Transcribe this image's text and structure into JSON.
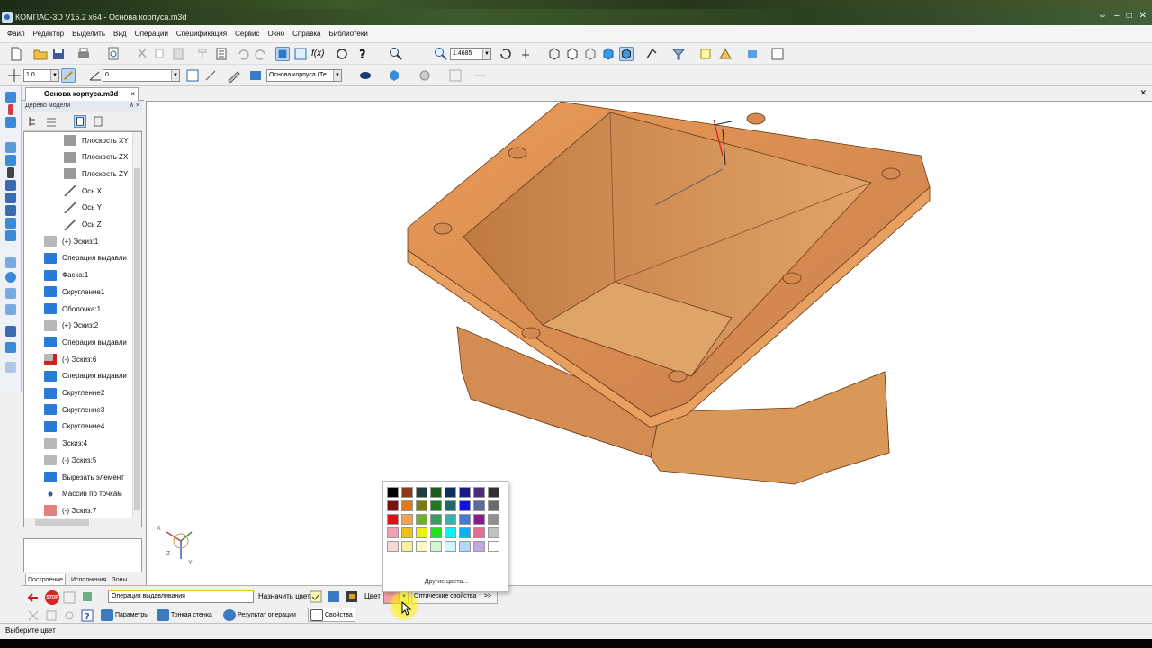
{
  "window": {
    "title": "КОМПАС-3D V15.2  x64 - Основа корпуса.m3d",
    "controls": [
      "⇔",
      "‒",
      "□",
      "✕"
    ]
  },
  "menu": [
    "Файл",
    "Редактор",
    "Выделить",
    "Вид",
    "Операции",
    "Спецификация",
    "Сервис",
    "Окно",
    "Справка",
    "Библиотеки"
  ],
  "toolbar": {
    "zoom_value": "1.4685",
    "step_value": "1.0",
    "angle_value": "0",
    "layer_value": "Основа корпуса (Те"
  },
  "document_tab": {
    "label": "Основа корпуса.m3d",
    "close": "×"
  },
  "tree": {
    "header": "Дерево модели",
    "pin": "⊼ ×",
    "items": [
      {
        "label": "Плоскость XY",
        "icon": "plane-icon",
        "indent": 2
      },
      {
        "label": "Плоскость ZX",
        "icon": "plane-icon",
        "indent": 2
      },
      {
        "label": "Плоскость ZY",
        "icon": "plane-icon",
        "indent": 2
      },
      {
        "label": "Ось X",
        "icon": "axis-icon",
        "indent": 2
      },
      {
        "label": "Ось Y",
        "icon": "axis-icon",
        "indent": 2
      },
      {
        "label": "Ось Z",
        "icon": "axis-icon",
        "indent": 2
      },
      {
        "label": "(+) Эскиз:1",
        "icon": "sketch-icon",
        "indent": 1
      },
      {
        "label": "Операция выдавли",
        "icon": "extrude-icon",
        "indent": 1
      },
      {
        "label": "Фаска:1",
        "icon": "chamfer-icon",
        "indent": 1
      },
      {
        "label": "Скругление1",
        "icon": "fillet-icon",
        "indent": 1
      },
      {
        "label": "Оболочка:1",
        "icon": "shell-icon",
        "indent": 1
      },
      {
        "label": "(+) Эскиз:2",
        "icon": "sketch-icon",
        "indent": 1
      },
      {
        "label": "Операция выдавли",
        "icon": "extrude-icon",
        "indent": 1
      },
      {
        "label": "(-) Эскиз:6",
        "icon": "sketch-error-icon",
        "indent": 1
      },
      {
        "label": "Операция выдавли",
        "icon": "extrude-icon",
        "indent": 1
      },
      {
        "label": "Скругление2",
        "icon": "fillet-icon",
        "indent": 1
      },
      {
        "label": "Скругление3",
        "icon": "fillet-icon",
        "indent": 1
      },
      {
        "label": "Скругление4",
        "icon": "fillet-icon",
        "indent": 1
      },
      {
        "label": "Эскиз:4",
        "icon": "sketch-icon",
        "indent": 1
      },
      {
        "label": "(-) Эскиз:5",
        "icon": "sketch-icon",
        "indent": 1
      },
      {
        "label": "Вырезать элемент",
        "icon": "cut-icon",
        "indent": 1
      },
      {
        "label": "Массив по точкам",
        "icon": "pattern-icon",
        "indent": 1
      },
      {
        "label": "(-) Эскиз:7",
        "icon": "sketch-red-icon",
        "indent": 1
      }
    ],
    "bottom_tabs": [
      "Построение",
      "Исполнения",
      "Зоны"
    ]
  },
  "properties": {
    "operation_name": "Операция выдавливания",
    "assign_color_label": "Назначить цвет",
    "color_label": "Цвет",
    "optical_label": "Оптические свойства",
    "optical_more": ">>",
    "tabs": [
      "Параметры",
      "Тонкая стенка",
      "Результат операции",
      "Свойства"
    ],
    "stop_label": "STOP"
  },
  "palette": {
    "colors": [
      "#000000",
      "#8b3a1a",
      "#1f3f3f",
      "#1f5a1f",
      "#0f2f5f",
      "#1a1a8a",
      "#4a2a7a",
      "#303030",
      "#7a1010",
      "#e07a20",
      "#7a7a10",
      "#1e7a1e",
      "#1e6a6a",
      "#1010e0",
      "#5a6a9a",
      "#6a6a6a",
      "#e01010",
      "#f5a050",
      "#70b030",
      "#3a9a60",
      "#3ab0b0",
      "#4a7ad0",
      "#8a1a8a",
      "#909090",
      "#f0a0b0",
      "#f0c020",
      "#f0f010",
      "#20e020",
      "#10f0f0",
      "#10b0f0",
      "#e07090",
      "#c0c0c0",
      "#f8d8d0",
      "#f8f0a0",
      "#f8f8c0",
      "#d0f8d0",
      "#d0f8f8",
      "#b0d8f8",
      "#c0a8e8",
      "#ffffff"
    ],
    "more_label": "Другие цвета...",
    "current_color": "#f0a0a0"
  },
  "status": "Выберите цвет",
  "axis_labels": {
    "x": "X",
    "y": "Y",
    "z": "Z"
  }
}
